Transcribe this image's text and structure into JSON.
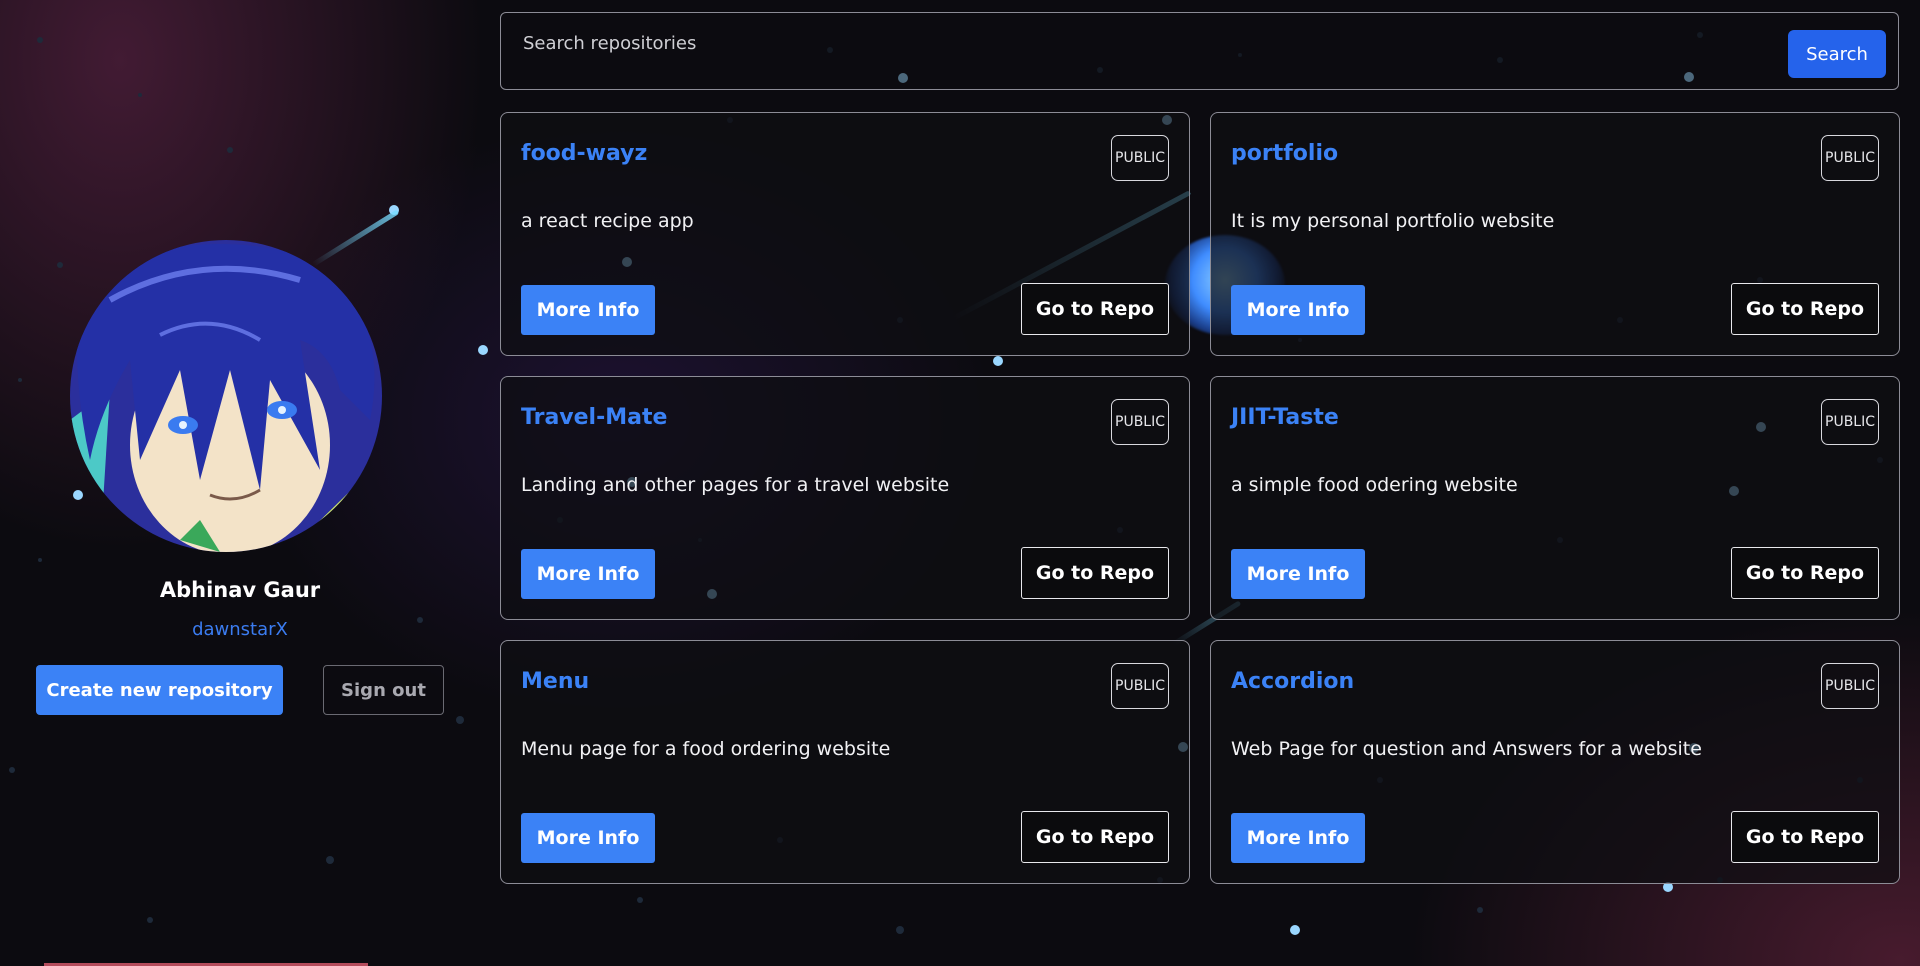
{
  "profile": {
    "name": "Abhinav Gaur",
    "username": "dawnstarX",
    "avatar_icon": "anime-avatar"
  },
  "actions": {
    "create_label": "Create new repository",
    "signout_label": "Sign out"
  },
  "search": {
    "placeholder": "Search repositories",
    "button_label": "Search"
  },
  "repos": [
    {
      "name": "food-wayz",
      "badge": "PUBLIC",
      "description": "a react recipe app",
      "more_info": "More Info",
      "go_repo": "Go to Repo"
    },
    {
      "name": "portfolio",
      "badge": "PUBLIC",
      "description": "It is my personal portfolio website",
      "more_info": "More Info",
      "go_repo": "Go to Repo"
    },
    {
      "name": "Travel-Mate",
      "badge": "PUBLIC",
      "description": "Landing and other pages for a travel website",
      "more_info": "More Info",
      "go_repo": "Go to Repo"
    },
    {
      "name": "JIIT-Taste",
      "badge": "PUBLIC",
      "description": "a simple food odering website",
      "more_info": "More Info",
      "go_repo": "Go to Repo"
    },
    {
      "name": "Menu",
      "badge": "PUBLIC",
      "description": "Menu page for a food ordering website",
      "more_info": "More Info",
      "go_repo": "Go to Repo"
    },
    {
      "name": "Accordion",
      "badge": "PUBLIC",
      "description": "Web Page for question and Answers for a website",
      "more_info": "More Info",
      "go_repo": "Go to Repo"
    }
  ],
  "colors": {
    "accent": "#3b82f6",
    "search_button": "#2563eb",
    "background": "#0c0b10"
  }
}
